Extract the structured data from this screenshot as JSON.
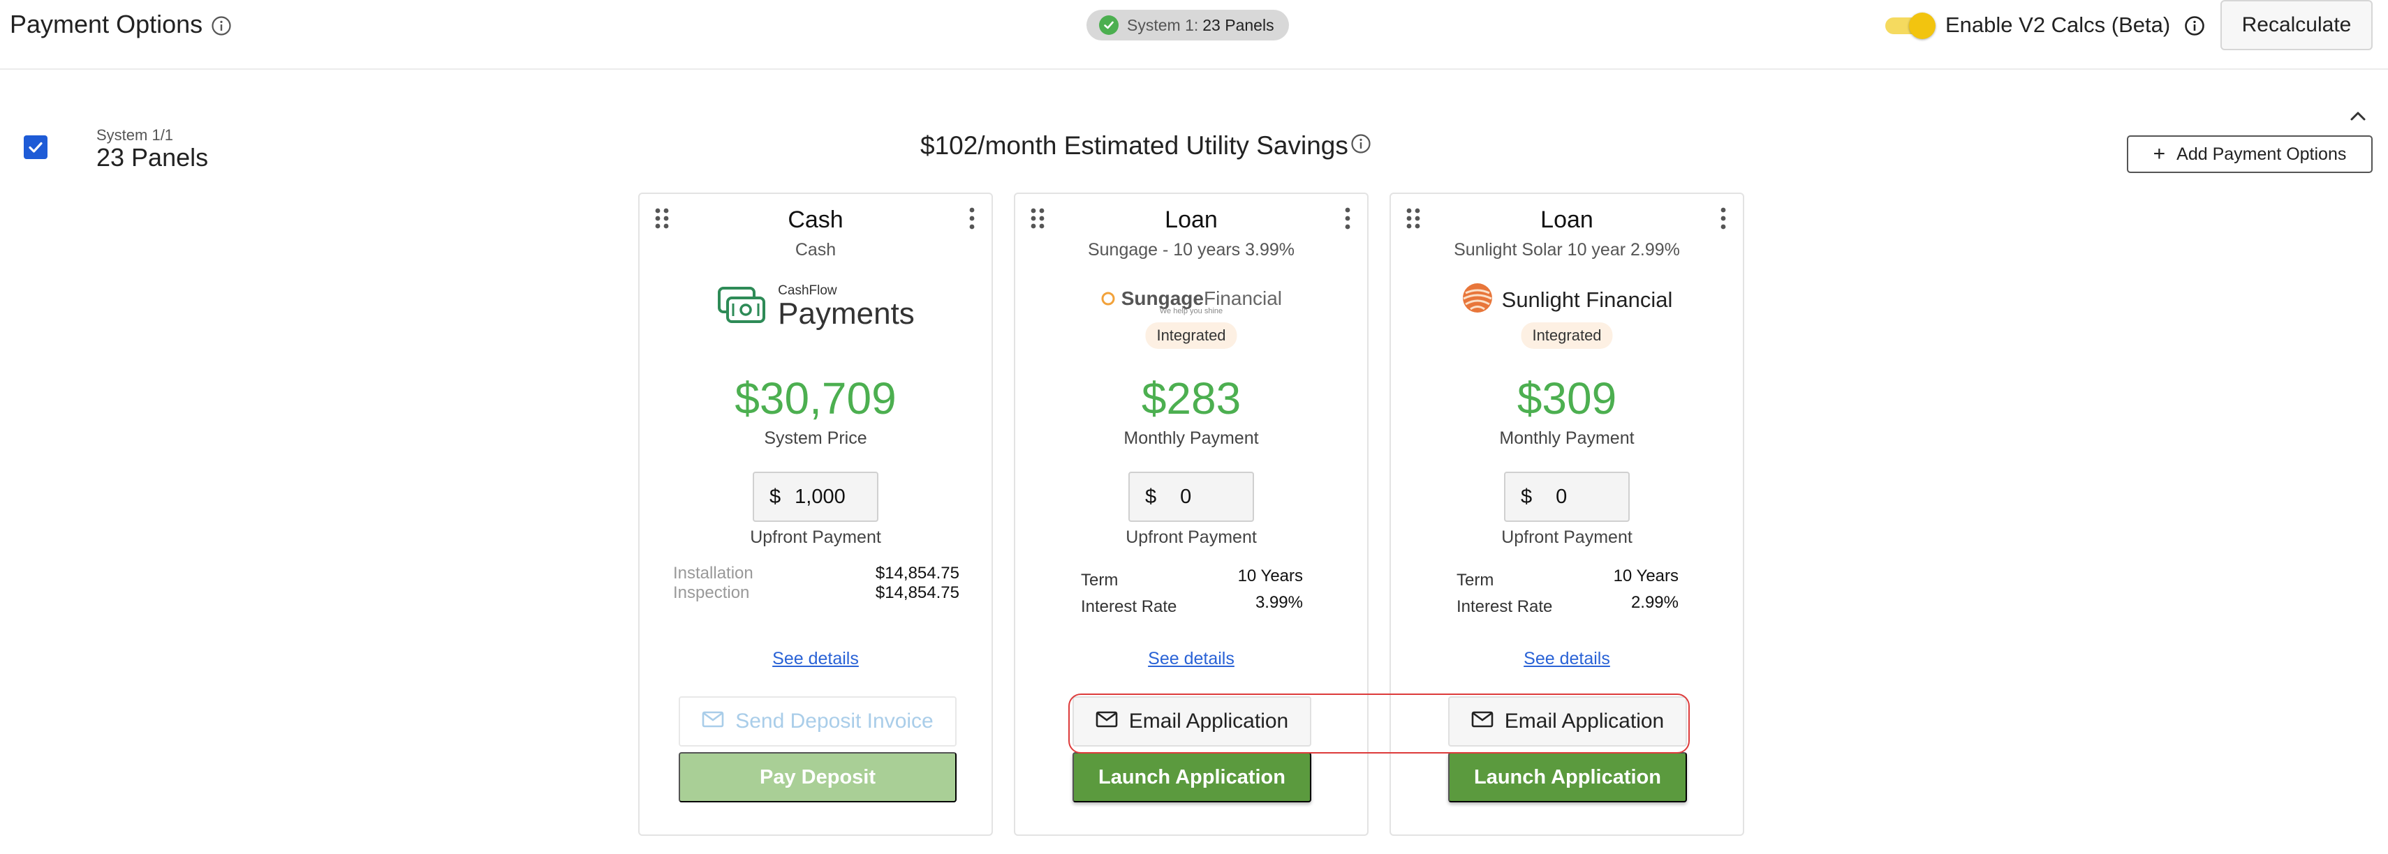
{
  "header": {
    "title": "Payment Options",
    "system_pill": {
      "label": "System 1:",
      "value": "23 Panels"
    },
    "toggle_label": "Enable V2 Calcs (Beta)",
    "toggle_on": true,
    "recalculate_label": "Recalculate"
  },
  "system": {
    "checked": true,
    "label": "System 1/1",
    "panels": "23 Panels",
    "savings": "$102/month Estimated Utility Savings",
    "add_button": "Add Payment Options"
  },
  "cards": [
    {
      "title": "Cash",
      "subtitle": "Cash",
      "logo": {
        "small": "CashFlow",
        "big": "Payments"
      },
      "amount": "$30,709",
      "amount_label": "System Price",
      "upfront_currency": "$",
      "upfront_value": "1,000",
      "upfront_label": "Upfront Payment",
      "details": [
        {
          "label": "Installation",
          "value": "$14,854.75"
        },
        {
          "label": "Inspection",
          "value": "$14,854.75"
        }
      ],
      "see_details": "See details",
      "secondary_button": "Send Deposit Invoice",
      "primary_button": "Pay Deposit"
    },
    {
      "title": "Loan",
      "subtitle": "Sungage - 10 years 3.99%",
      "logo": {
        "brand": "Sungage",
        "suffix": "Financial",
        "tagline": "We help you shine"
      },
      "badge": "Integrated",
      "amount": "$283",
      "amount_label": "Monthly Payment",
      "upfront_currency": "$",
      "upfront_value": "0",
      "upfront_label": "Upfront Payment",
      "details": [
        {
          "label": "Term",
          "value": "10 Years"
        },
        {
          "label": "Interest Rate",
          "value": "3.99%"
        }
      ],
      "see_details": "See details",
      "secondary_button": "Email Application",
      "primary_button": "Launch Application"
    },
    {
      "title": "Loan",
      "subtitle": "Sunlight Solar 10 year 2.99%",
      "logo": {
        "brand": "Sunlight Financial"
      },
      "badge": "Integrated",
      "amount": "$309",
      "amount_label": "Monthly Payment",
      "upfront_currency": "$",
      "upfront_value": "0",
      "upfront_label": "Upfront Payment",
      "details": [
        {
          "label": "Term",
          "value": "10 Years"
        },
        {
          "label": "Interest Rate",
          "value": "2.99%"
        }
      ],
      "see_details": "See details",
      "secondary_button": "Email Application",
      "primary_button": "Launch Application"
    }
  ],
  "colors": {
    "accent_green": "#4caf50",
    "button_green": "#5b9a3e",
    "link_blue": "#2962d6",
    "checkbox_blue": "#1e5bd6",
    "toggle_yellow": "#f2c40f",
    "highlight_red": "#dd3b3b"
  },
  "icons": [
    "info-icon",
    "check-circle-icon",
    "chevron-up-icon",
    "plus-icon",
    "drag-handle-icon",
    "more-vert-icon",
    "mail-icon",
    "cashflow-logo-icon",
    "sungage-logo-icon",
    "sunlight-logo-icon"
  ]
}
